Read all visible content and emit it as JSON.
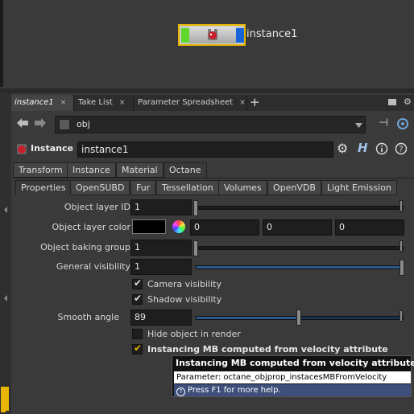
{
  "network": {
    "node_label": "instance1",
    "node_colors": {
      "left": "#5fd82b",
      "right": "#1565d8",
      "selected_border": "#e8b500"
    }
  },
  "pane_tabs": [
    {
      "label": "instance1"
    },
    {
      "label": "Take List"
    },
    {
      "label": "Parameter Spreadsheet"
    }
  ],
  "pane_tab_close": "×",
  "add_tab": "+",
  "path": {
    "value": "obj"
  },
  "header": {
    "node_type": "Instance",
    "node_name": "instance1",
    "help_letter": "H"
  },
  "main_tabs": [
    "Transform",
    "Instance",
    "Material",
    "Octane"
  ],
  "sub_tabs": [
    "Properties",
    "OpenSUBD",
    "Fur",
    "Tessellation",
    "Volumes",
    "OpenVDB",
    "Light Emission"
  ],
  "params": {
    "layer_id": {
      "label": "Object layer ID",
      "value": "1"
    },
    "layer_color": {
      "label": "Object layer color",
      "r": "0",
      "g": "0",
      "b": "0",
      "swatch": "#000000"
    },
    "baking_group": {
      "label": "Object baking group",
      "value": "1"
    },
    "general_visibility": {
      "label": "General visibility",
      "value": "1",
      "fill": 1.0
    },
    "camera_visibility": {
      "label": "Camera visibility",
      "checked": true
    },
    "shadow_visibility": {
      "label": "Shadow visibility",
      "checked": true
    },
    "smooth_angle": {
      "label": "Smooth angle",
      "value": "89"
    },
    "hide_object": {
      "label": "Hide object in render",
      "checked": false
    },
    "instancing_mb": {
      "label": "Instancing MB computed from velocity attribute",
      "checked": true
    }
  },
  "tooltip": {
    "title": "Instancing MB computed from velocity attribute",
    "parameter": "Parameter: octane_objprop_instacesMBFromVelocity",
    "help": "Press F1 for more help."
  },
  "colors": {
    "accent": "#e8b500",
    "slider_fill": "#2a5a8a",
    "tooltip_help_bg": "#3d4f7a"
  }
}
